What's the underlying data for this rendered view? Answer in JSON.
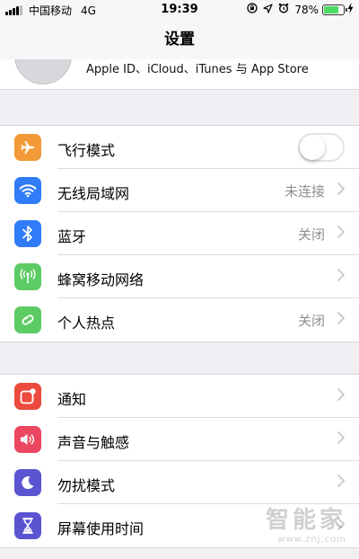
{
  "status_bar": {
    "carrier": "中国移动",
    "network": "4G",
    "time": "19:39",
    "battery_percent": "78%",
    "battery_level": 0.78,
    "icons": [
      "signal-icon",
      "lock-rotation-icon",
      "location-icon",
      "alarm-icon",
      "battery-icon",
      "charging-icon"
    ]
  },
  "nav": {
    "title": "设置"
  },
  "profile": {
    "subtitle": "Apple ID、iCloud、iTunes 与 App Store"
  },
  "group1": [
    {
      "label": "飞行模式",
      "icon": "airplane-icon",
      "color": "#f29a38",
      "toggle": true,
      "toggle_on": false
    },
    {
      "label": "无线局域网",
      "icon": "wifi-icon",
      "color": "#2f7cf6",
      "value": "未连接"
    },
    {
      "label": "蓝牙",
      "icon": "bluetooth-icon",
      "color": "#2f7cf6",
      "value": "关闭"
    },
    {
      "label": "蜂窝移动网络",
      "icon": "cellular-icon",
      "color": "#5ccb64",
      "value": ""
    },
    {
      "label": "个人热点",
      "icon": "hotspot-icon",
      "color": "#5ccb64",
      "value": "关闭"
    }
  ],
  "group2": [
    {
      "label": "通知",
      "icon": "notifications-icon",
      "color": "#ea4b3e"
    },
    {
      "label": "声音与触感",
      "icon": "sound-icon",
      "color": "#ec4760"
    },
    {
      "label": "勿扰模式",
      "icon": "moon-icon",
      "color": "#5b54d1"
    },
    {
      "label": "屏幕使用时间",
      "icon": "hourglass-icon",
      "color": "#5b54d1"
    }
  ],
  "watermark": {
    "main": "智能家",
    "sub": "www.znj.com"
  }
}
